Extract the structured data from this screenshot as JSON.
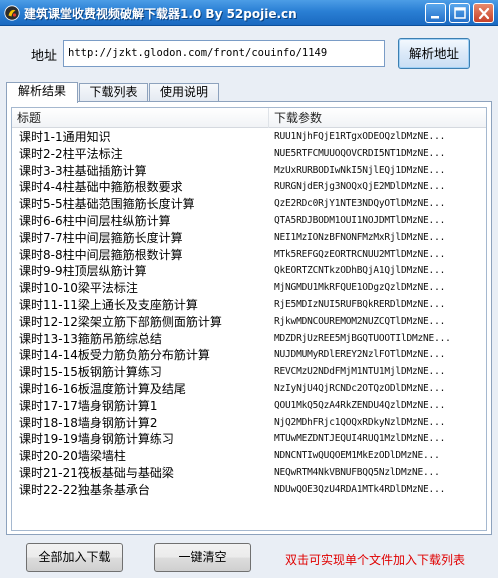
{
  "window": {
    "title": "建筑课堂收费视频破解下载器1.0 By 52pojie.cn"
  },
  "address": {
    "label": "地址",
    "value": "http://jzkt.glodon.com/front/couinfo/1149",
    "parse_button": "解析地址"
  },
  "tabs": [
    {
      "label": "解析结果",
      "active": true
    },
    {
      "label": "下载列表",
      "active": false
    },
    {
      "label": "使用说明",
      "active": false
    }
  ],
  "table": {
    "columns": [
      "标题",
      "下载参数"
    ],
    "rows": [
      {
        "title": "课时1-1通用知识",
        "param": "RUU1NjhFQjE1RTgxODEOQzlDMzNE..."
      },
      {
        "title": "课时2-2柱平法标注",
        "param": "NUE5RTFCMUUOQOVCRDI5NT1DMzNE..."
      },
      {
        "title": "课时3-3柱基础插筋计算",
        "param": "MzUxRURBODIwNkI5NjlEQj1DMzNE..."
      },
      {
        "title": "课时4-4柱基础中箍筋根数要求",
        "param": "RURGNjdERjg3NOQxQjE2MDlDMzNE..."
      },
      {
        "title": "课时5-5柱基础范围箍筋长度计算",
        "param": "QzE2RDc0RjY1NTE3NDQyOTlDMzNE..."
      },
      {
        "title": "课时6-6柱中间层柱纵筋计算",
        "param": "QTA5RDJBODM1OUI1NOJDMTlDMzNE..."
      },
      {
        "title": "课时7-7柱中间层箍筋长度计算",
        "param": "NEI1MzIONzBFNONFMzMxRjlDMzNE..."
      },
      {
        "title": "课时8-8柱中间层箍筋根数计算",
        "param": "MTk5REFGQzEORTRCNUU2MTlDMzNE..."
      },
      {
        "title": "课时9-9柱顶层纵筋计算",
        "param": "QkEORTZCNTkzODhBQjA1QjlDMzNE..."
      },
      {
        "title": "课时10-10梁平法标注",
        "param": "MjNGMDU1MkRFQUE1ODgzQzlDMzNE..."
      },
      {
        "title": "课时11-11梁上通长及支座筋计算",
        "param": "RjE5MDIzNUI5RUFBQkRERDlDMzNE..."
      },
      {
        "title": "课时12-12梁架立筋下部筋侧面筋计算",
        "param": "RjkwMDNCOUREMOM2NUZCQTlDMzNE..."
      },
      {
        "title": "课时13-13箍筋吊筋综总结",
        "param": "MDZDRjUzREE5MjBGQTUOOTIlDMzNE..."
      },
      {
        "title": "课时14-14板受力筋负筋分布筋计算",
        "param": "NUJDMUMyRDlEREY2NzlFOTlDMzNE..."
      },
      {
        "title": "课时15-15板钢筋计算练习",
        "param": "REVCMzU2NDdFMjM1NTU1MjlDMzNE..."
      },
      {
        "title": "课时16-16板温度筋计算及结尾",
        "param": "NzIyNjU4QjRCNDc2OTQzODlDMzNE..."
      },
      {
        "title": "课时17-17墙身钢筋计算1",
        "param": "QOU1MkQ5QzA4RkZENDU4QzlDMzNE..."
      },
      {
        "title": "课时18-18墙身钢筋计算2",
        "param": "NjQ2MDhFRjc1QOQxRDkyNzlDMzNE..."
      },
      {
        "title": "课时19-19墙身钢筋计算练习",
        "param": "MTUwMEZDNTJEQUI4RUQ1MzlDMzNE..."
      },
      {
        "title": "课时20-20墙梁墙柱",
        "param": "NDNCNTIwQUQOEM1MkEzODlDMzNE..."
      },
      {
        "title": "课时21-21筏板基础与基础梁",
        "param": "NEQwRTM4NkVBNUFBQQ5NzlDMzNE..."
      },
      {
        "title": "课时22-22独基条基承台",
        "param": "NDUwQOE3QzU4RDA1MTk4RDlDMzNE..."
      }
    ]
  },
  "footer": {
    "add_all_button": "全部加入下载",
    "clear_button": "一键清空",
    "hint": "双击可实现单个文件加入下载列表"
  },
  "colors": {
    "titlebar": "#2a7fd4",
    "hint_text": "#e00000",
    "background": "#e9eef5"
  }
}
